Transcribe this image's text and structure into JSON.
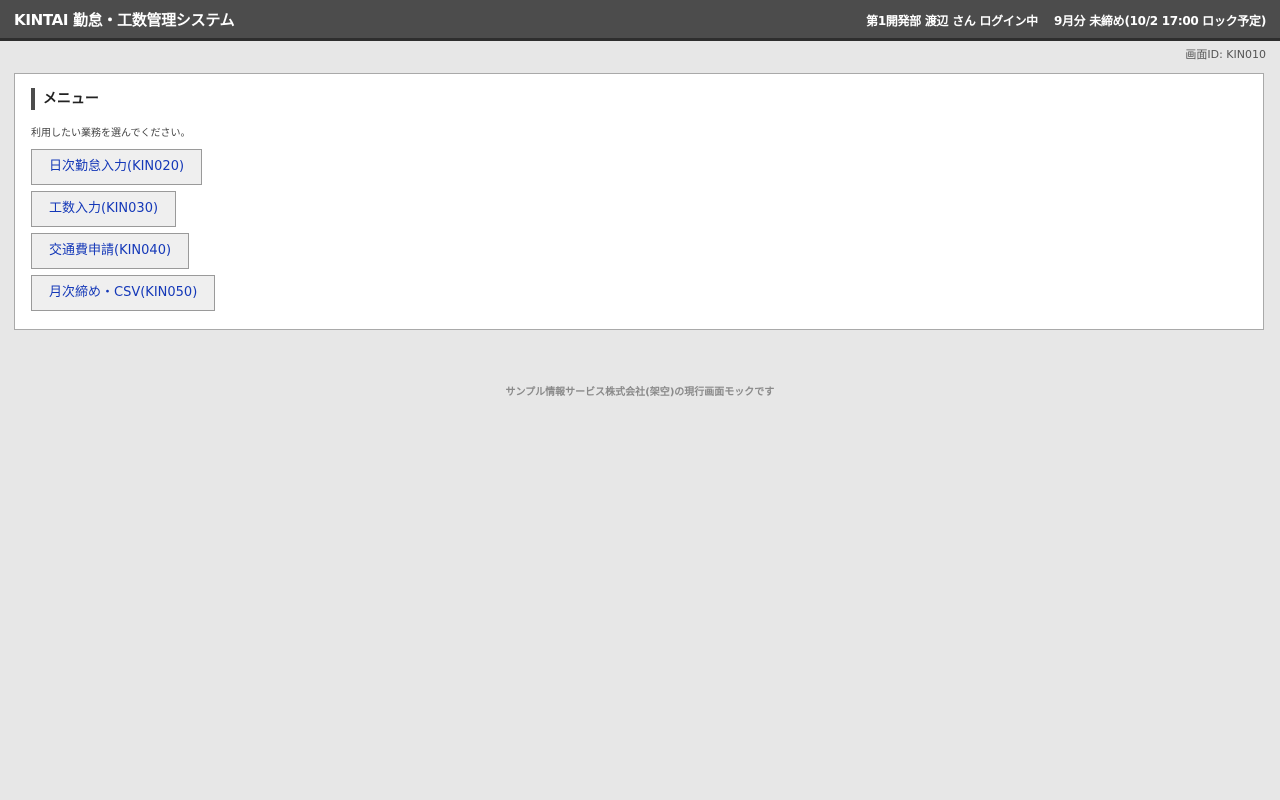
{
  "header": {
    "app_title": "KINTAI 勤怠・工数管理システム",
    "user_status": "第1開発部 渡辺 さん ログイン中",
    "period_status": "9月分 未締め(10/2 17:00 ロック予定)"
  },
  "screen_id": "画面ID: KIN010",
  "menu": {
    "title": "メニュー",
    "instruction": "利用したい業務を選んでください。",
    "items": [
      {
        "label": "日次勤怠入力(KIN020)"
      },
      {
        "label": "工数入力(KIN030)"
      },
      {
        "label": "交通費申請(KIN040)"
      },
      {
        "label": "月次締め・CSV(KIN050)"
      }
    ]
  },
  "footer": {
    "note": "サンプル情報サービス株式会社(架空)の現行画面モックです"
  },
  "colors": {
    "header_bg": "#4c4c4c",
    "page_bg": "#e7e7e7",
    "link_text": "#1438b8"
  }
}
